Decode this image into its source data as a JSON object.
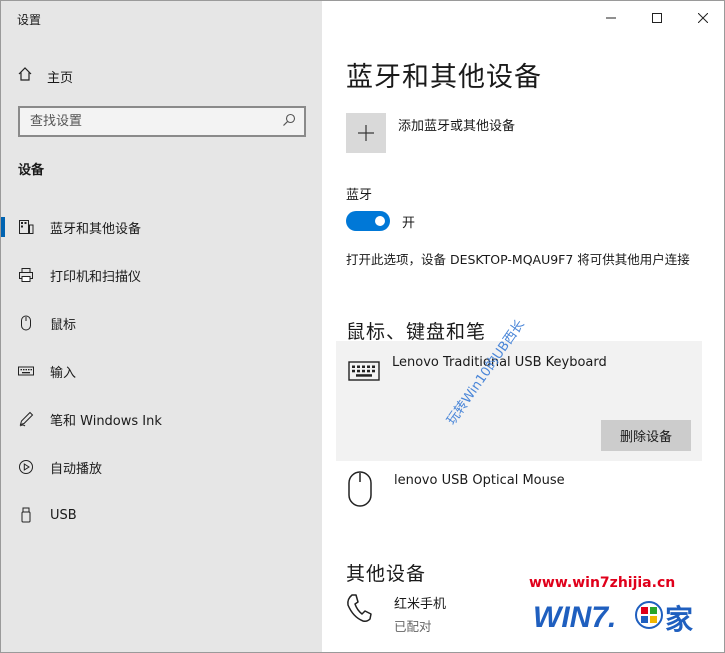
{
  "window": {
    "title": "设置"
  },
  "sidebar": {
    "home_label": "主页",
    "search_placeholder": "查找设置",
    "section_label": "设备",
    "items": [
      {
        "label": "蓝牙和其他设备",
        "icon": "bluetooth-devices-icon",
        "active": true
      },
      {
        "label": "打印机和扫描仪",
        "icon": "printer-icon",
        "active": false
      },
      {
        "label": "鼠标",
        "icon": "mouse-icon",
        "active": false
      },
      {
        "label": "输入",
        "icon": "keyboard-icon",
        "active": false
      },
      {
        "label": "笔和 Windows Ink",
        "icon": "pen-icon",
        "active": false
      },
      {
        "label": "自动播放",
        "icon": "autoplay-icon",
        "active": false
      },
      {
        "label": "USB",
        "icon": "usb-icon",
        "active": false
      }
    ]
  },
  "content": {
    "title": "蓝牙和其他设备",
    "add_device_label": "添加蓝牙或其他设备",
    "bluetooth_label": "蓝牙",
    "bluetooth_state": "开",
    "discoverable_text": "打开此选项，设备 DESKTOP-MQAU9F7 将可供其他用户连接",
    "mouse_keyboard_pen_heading": "鼠标、键盘和笔",
    "keyboard_device": "Lenovo Traditional USB Keyboard",
    "remove_device_label": "删除设备",
    "mouse_device": "lenovo USB Optical Mouse",
    "other_devices_heading": "其他设备",
    "phone_device": "红米手机",
    "phone_status": "已配对"
  },
  "watermark": {
    "diagonal_text": "玩转Win10的UB西长",
    "site_url": "www.win7zhijia.cn",
    "logo_text": "WIN7.家"
  },
  "colors": {
    "accent": "#0078d7",
    "sidebar_bg": "#e6e6e6",
    "brand_red": "#e0001b",
    "brand_blue": "#1f5fbf"
  }
}
